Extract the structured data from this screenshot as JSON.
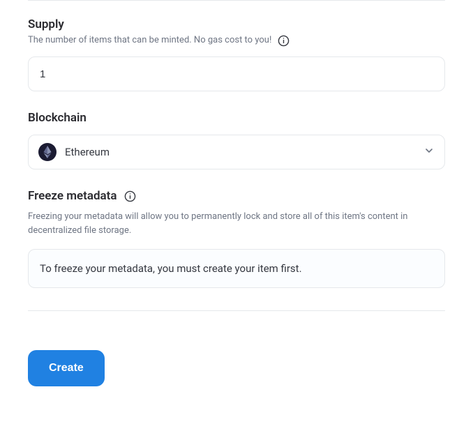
{
  "supply": {
    "label": "Supply",
    "description": "The number of items that can be minted. No gas cost to you!",
    "value": "1"
  },
  "blockchain": {
    "label": "Blockchain",
    "selected": "Ethereum"
  },
  "freeze": {
    "label": "Freeze metadata",
    "description": "Freezing your metadata will allow you to permanently lock and store all of this item's content in decentralized file storage.",
    "notice": "To freeze your metadata, you must create your item first."
  },
  "actions": {
    "create_label": "Create"
  }
}
